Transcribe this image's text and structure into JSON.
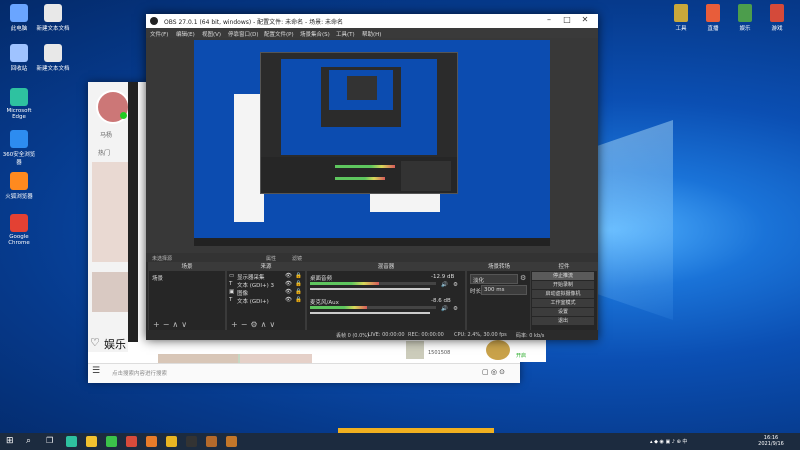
{
  "desktop": {
    "left_icons": [
      {
        "label": "此电脑",
        "color": "#6aa5ff"
      },
      {
        "label": "新建文本文档",
        "color": "#e8e8e8"
      },
      {
        "label": "回收站",
        "color": "#9fc3ff"
      },
      {
        "label": "新建文本文档",
        "color": "#e8e8e8"
      },
      {
        "label": "Microsoft Edge",
        "color": "#2ec2a0"
      },
      {
        "label": "360安全浏览器",
        "color": "#2d8cf0"
      },
      {
        "label": "火狐浏览器",
        "color": "#ff8a1f"
      },
      {
        "label": "Google Chrome",
        "color": "#e34133"
      }
    ],
    "right_icons": [
      {
        "label": "工具",
        "color": "#c9a83b"
      },
      {
        "label": "直播",
        "color": "#e85d3a"
      },
      {
        "label": "娱乐",
        "color": "#4c9d4c"
      },
      {
        "label": "游戏",
        "color": "#d44a3a"
      }
    ]
  },
  "bg_app": {
    "nav_label_1": "马杨",
    "nav_label_2": "热门",
    "entertainment_label": "娱乐",
    "search_placeholder": "点击搜索内容进行搜索",
    "side_info": "1501508",
    "side_info_2": "开启"
  },
  "obs": {
    "title": "OBS 27.0.1 (64 bit, windows) - 配置文件: 未命名 - 场景: 未命名",
    "menu": [
      "文件(F)",
      "编辑(E)",
      "视图(V)",
      "停靠窗口(D)",
      "配置文件(P)",
      "场景集合(S)",
      "工具(T)",
      "帮助(H)"
    ],
    "context_bar": {
      "no_source": "未选择源",
      "properties": "属性",
      "filters": "滤镜"
    },
    "scenes_panel": {
      "title": "场景",
      "items": [
        "场景"
      ]
    },
    "sources_panel": {
      "title": "来源",
      "items": [
        "显示器采集",
        "文本 (GDI+) 3",
        "图像",
        "文本 (GDI+)"
      ]
    },
    "mixer_panel": {
      "title": "混音器",
      "channels": [
        {
          "name": "桌面音频",
          "db": "-12.9 dB",
          "level": 0.55
        },
        {
          "name": "麦克风/Aux",
          "db": "-8.6 dB",
          "level": 0.45
        }
      ]
    },
    "transitions_panel": {
      "title": "场景转场",
      "transition": "淡化",
      "duration_label": "时长",
      "duration_value": "300 ms"
    },
    "controls_panel": {
      "title": "控件",
      "buttons": [
        "停止推流",
        "开始录制",
        "启动虚拟摄像机",
        "工作室模式",
        "设置",
        "退出"
      ]
    },
    "status": {
      "dropped": "丢帧 0 (0.0%)",
      "live": "LIVE: 00:00:00",
      "rec": "REC: 00:00:00",
      "cpu": "CPU: 2.4%, 30.00 fps",
      "bitrate": "码率: 0 kb/s"
    }
  },
  "taskbar": {
    "apps": [
      {
        "name": "search-icon",
        "color": "#ffffff"
      },
      {
        "name": "task-view-icon",
        "color": "#ffffff"
      },
      {
        "name": "edge-icon",
        "color": "#2ec2a0"
      },
      {
        "name": "explorer-icon",
        "color": "#f2c230"
      },
      {
        "name": "wechat-icon",
        "color": "#3bc34a"
      },
      {
        "name": "app-red-icon",
        "color": "#d84b3b"
      },
      {
        "name": "app-orange-icon",
        "color": "#e87c2a"
      },
      {
        "name": "app-yellow-icon",
        "color": "#e9b523"
      },
      {
        "name": "obs-icon",
        "color": "#333333"
      },
      {
        "name": "app-brown-icon",
        "color": "#b46a2c"
      },
      {
        "name": "app-brown2-icon",
        "color": "#c3772a"
      }
    ],
    "time": "16:16",
    "date": "2021/9/16"
  }
}
